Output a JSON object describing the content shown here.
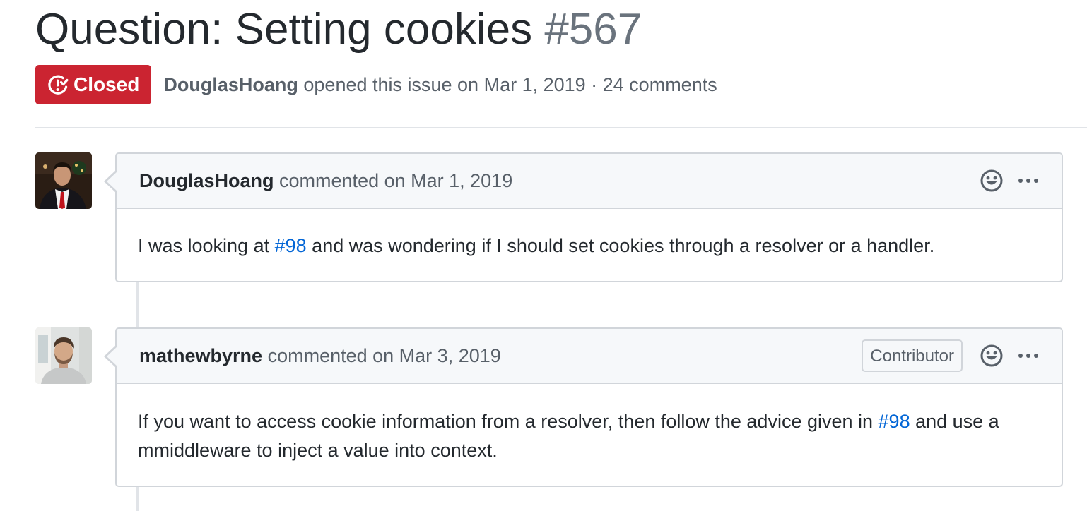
{
  "issue": {
    "title": "Question: Setting cookies",
    "number": "#567",
    "state": "Closed",
    "author": "DouglasHoang",
    "opened_text": "opened this issue on Mar 1, 2019 · 24 comments",
    "state_color": "#cb2431"
  },
  "comments": [
    {
      "author": "DouglasHoang",
      "header_text": "commented on Mar 1, 2019",
      "avatar": "avatar-photo-douglashoang",
      "body": {
        "before_link": "I was looking at ",
        "link": "#98",
        "after_link": " and was wondering if I should set cookies through a resolver or a handler."
      }
    },
    {
      "author": "mathewbyrne",
      "header_text": "commented on Mar 3, 2019",
      "role": "Contributor",
      "avatar": "avatar-photo-mathewbyrne",
      "body": {
        "before_link": "If you want to access cookie information from a resolver, then follow the advice given in ",
        "link": "#98",
        "after_link": " and use a mmiddleware to inject a value into context."
      }
    }
  ],
  "icons": {
    "state": "issue-closed-icon",
    "reaction": "smiley-icon",
    "more": "kebab-horizontal-icon"
  },
  "colors": {
    "link": "#0366d6",
    "muted": "#586069",
    "border": "#d1d5da",
    "header_bg": "#f6f8fa"
  }
}
